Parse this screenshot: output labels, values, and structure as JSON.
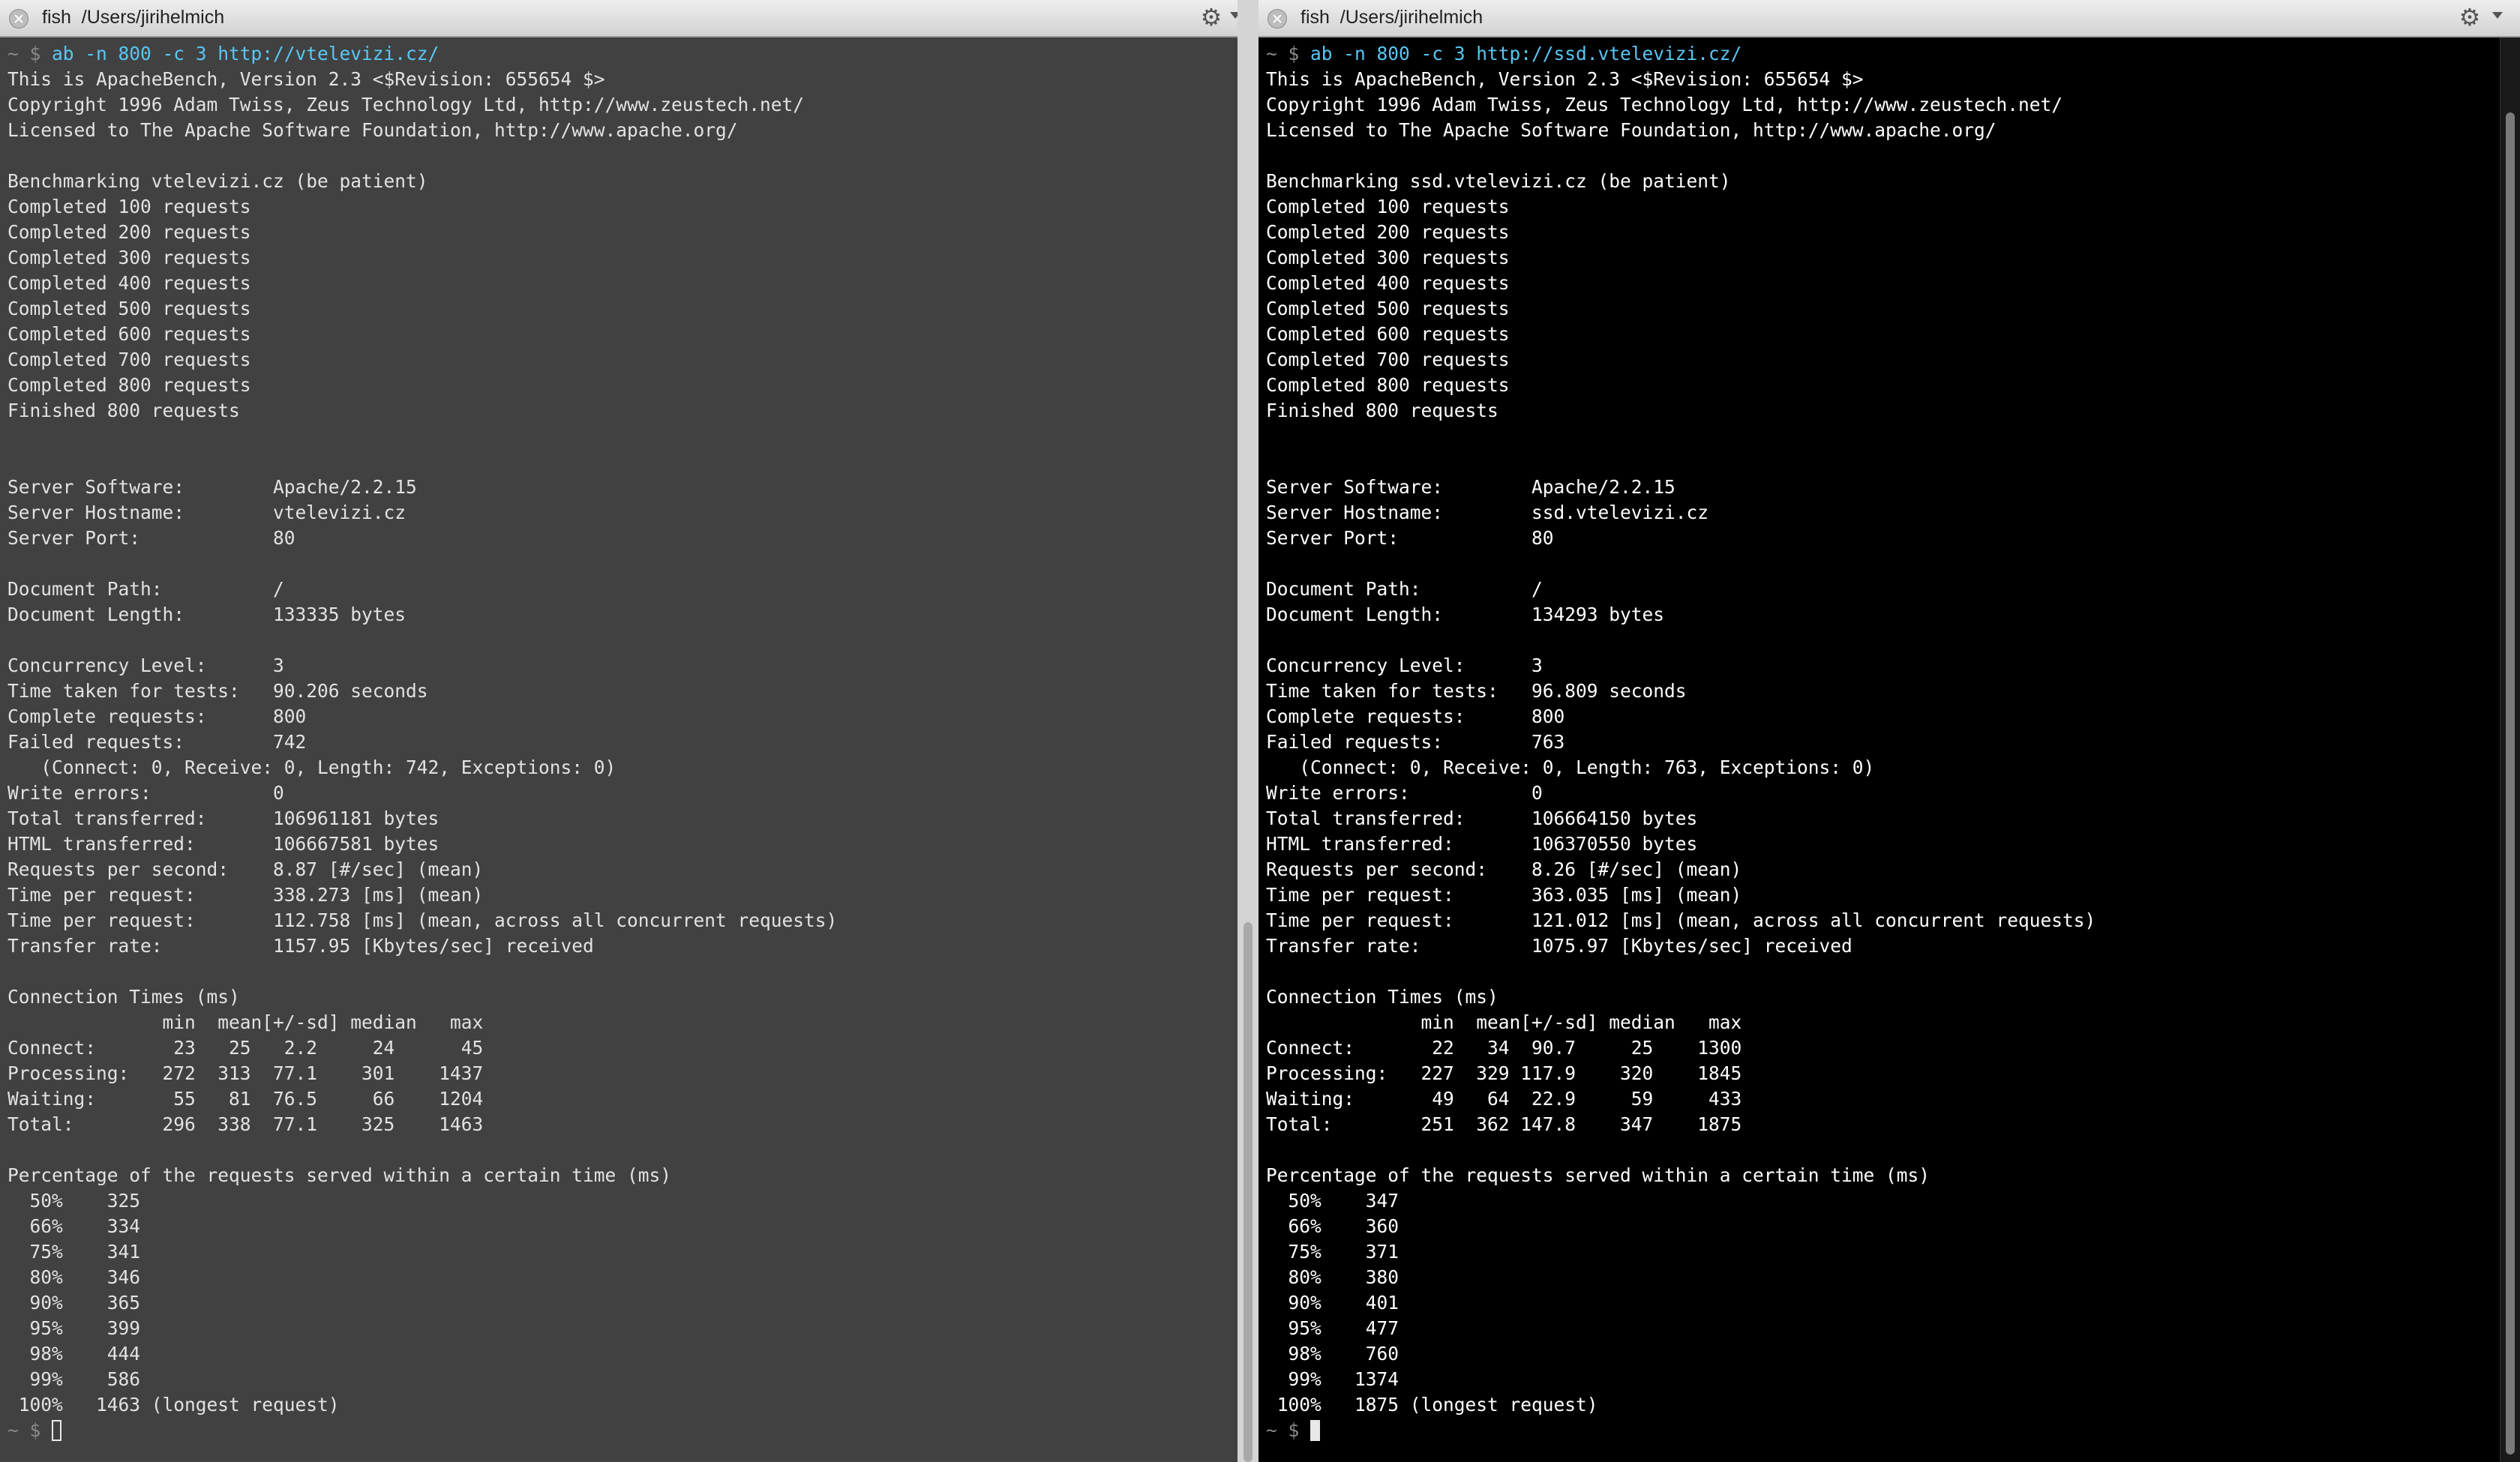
{
  "left": {
    "tab": {
      "title": "fish  /Users/jirihelmich"
    },
    "prompt": "~ $ ",
    "command": "ab -n 800 -c 3 http://vtelevizi.cz/",
    "lines": [
      "This is ApacheBench, Version 2.3 <$Revision: 655654 $>",
      "Copyright 1996 Adam Twiss, Zeus Technology Ltd, http://www.zeustech.net/",
      "Licensed to The Apache Software Foundation, http://www.apache.org/",
      "",
      "Benchmarking vtelevizi.cz (be patient)",
      "Completed 100 requests",
      "Completed 200 requests",
      "Completed 300 requests",
      "Completed 400 requests",
      "Completed 500 requests",
      "Completed 600 requests",
      "Completed 700 requests",
      "Completed 800 requests",
      "Finished 800 requests",
      "",
      "",
      "Server Software:        Apache/2.2.15",
      "Server Hostname:        vtelevizi.cz",
      "Server Port:            80",
      "",
      "Document Path:          /",
      "Document Length:        133335 bytes",
      "",
      "Concurrency Level:      3",
      "Time taken for tests:   90.206 seconds",
      "Complete requests:      800",
      "Failed requests:        742",
      "   (Connect: 0, Receive: 0, Length: 742, Exceptions: 0)",
      "Write errors:           0",
      "Total transferred:      106961181 bytes",
      "HTML transferred:       106667581 bytes",
      "Requests per second:    8.87 [#/sec] (mean)",
      "Time per request:       338.273 [ms] (mean)",
      "Time per request:       112.758 [ms] (mean, across all concurrent requests)",
      "Transfer rate:          1157.95 [Kbytes/sec] received",
      "",
      "Connection Times (ms)",
      "              min  mean[+/-sd] median   max",
      "Connect:       23   25   2.2     24      45",
      "Processing:   272  313  77.1    301    1437",
      "Waiting:       55   81  76.5     66    1204",
      "Total:        296  338  77.1    325    1463",
      "",
      "Percentage of the requests served within a certain time (ms)",
      "  50%    325",
      "  66%    334",
      "  75%    341",
      "  80%    346",
      "  90%    365",
      "  95%    399",
      "  98%    444",
      "  99%    586",
      " 100%   1463 (longest request)"
    ],
    "final_prompt": "~ $ "
  },
  "right": {
    "tab": {
      "title": "fish  /Users/jirihelmich"
    },
    "prompt": "~ $ ",
    "command": "ab -n 800 -c 3 http://ssd.vtelevizi.cz/",
    "lines": [
      "This is ApacheBench, Version 2.3 <$Revision: 655654 $>",
      "Copyright 1996 Adam Twiss, Zeus Technology Ltd, http://www.zeustech.net/",
      "Licensed to The Apache Software Foundation, http://www.apache.org/",
      "",
      "Benchmarking ssd.vtelevizi.cz (be patient)",
      "Completed 100 requests",
      "Completed 200 requests",
      "Completed 300 requests",
      "Completed 400 requests",
      "Completed 500 requests",
      "Completed 600 requests",
      "Completed 700 requests",
      "Completed 800 requests",
      "Finished 800 requests",
      "",
      "",
      "Server Software:        Apache/2.2.15",
      "Server Hostname:        ssd.vtelevizi.cz",
      "Server Port:            80",
      "",
      "Document Path:          /",
      "Document Length:        134293 bytes",
      "",
      "Concurrency Level:      3",
      "Time taken for tests:   96.809 seconds",
      "Complete requests:      800",
      "Failed requests:        763",
      "   (Connect: 0, Receive: 0, Length: 763, Exceptions: 0)",
      "Write errors:           0",
      "Total transferred:      106664150 bytes",
      "HTML transferred:       106370550 bytes",
      "Requests per second:    8.26 [#/sec] (mean)",
      "Time per request:       363.035 [ms] (mean)",
      "Time per request:       121.012 [ms] (mean, across all concurrent requests)",
      "Transfer rate:          1075.97 [Kbytes/sec] received",
      "",
      "Connection Times (ms)",
      "              min  mean[+/-sd] median   max",
      "Connect:       22   34  90.7     25    1300",
      "Processing:   227  329 117.9    320    1845",
      "Waiting:       49   64  22.9     59     433",
      "Total:        251  362 147.8    347    1875",
      "",
      "Percentage of the requests served within a certain time (ms)",
      "  50%    347",
      "  66%    360",
      "  75%    371",
      "  80%    380",
      "  90%    401",
      "  95%    477",
      "  98%    760",
      "  99%   1374",
      " 100%   1875 (longest request)"
    ],
    "final_prompt": "~ $ "
  },
  "icons": {
    "close": "close-icon",
    "settings": "gear-icon",
    "menu": "chevron-down-icon"
  },
  "colors": {
    "left_background": "#414141",
    "right_background": "#000000",
    "command": "#58c7f5",
    "text": "#e2e2e2"
  }
}
